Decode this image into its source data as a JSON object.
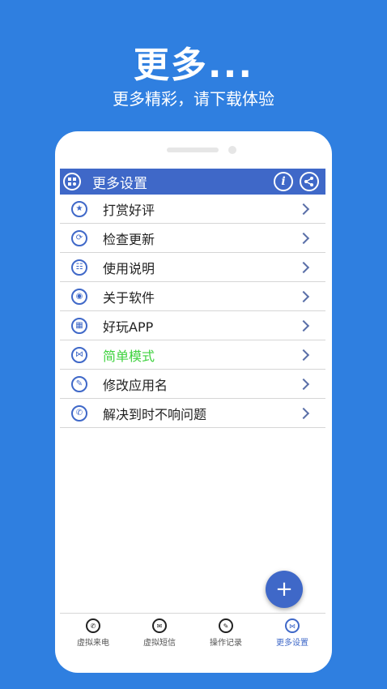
{
  "promo": {
    "headline": "更多...",
    "subline": "更多精彩，请下载体验"
  },
  "appbar": {
    "title": "更多设置",
    "left_icon": "settings-app-icon",
    "info_icon": "i",
    "share_icon": "share-icon"
  },
  "menu": {
    "items": [
      {
        "label": "打赏好评",
        "icon": "star-icon",
        "glyph": "★"
      },
      {
        "label": "检查更新",
        "icon": "refresh-icon",
        "glyph": "⟳"
      },
      {
        "label": "使用说明",
        "icon": "manual-icon",
        "glyph": "☷"
      },
      {
        "label": "关于软件",
        "icon": "eye-icon",
        "glyph": "◉"
      },
      {
        "label": "好玩APP",
        "icon": "app-icon",
        "glyph": "▦"
      },
      {
        "label": "简单模式",
        "icon": "mode-icon",
        "glyph": "⋈",
        "highlight": true
      },
      {
        "label": "修改应用名",
        "icon": "edit-name-icon",
        "glyph": "✎"
      },
      {
        "label": "解决到时不响问题",
        "icon": "phone-icon",
        "glyph": "✆"
      }
    ]
  },
  "fab": {
    "label": "+"
  },
  "nav": {
    "items": [
      {
        "label": "虚拟来电",
        "icon": "phone-call-icon",
        "glyph": "✆"
      },
      {
        "label": "虚拟短信",
        "icon": "message-icon",
        "glyph": "✉"
      },
      {
        "label": "操作记录",
        "icon": "record-icon",
        "glyph": "✎"
      },
      {
        "label": "更多设置",
        "icon": "more-settings-icon",
        "glyph": "⋈",
        "active": true
      }
    ]
  },
  "colors": {
    "background": "#2f7fe0",
    "accent": "#3f68c8",
    "highlight": "#3fd23f"
  }
}
